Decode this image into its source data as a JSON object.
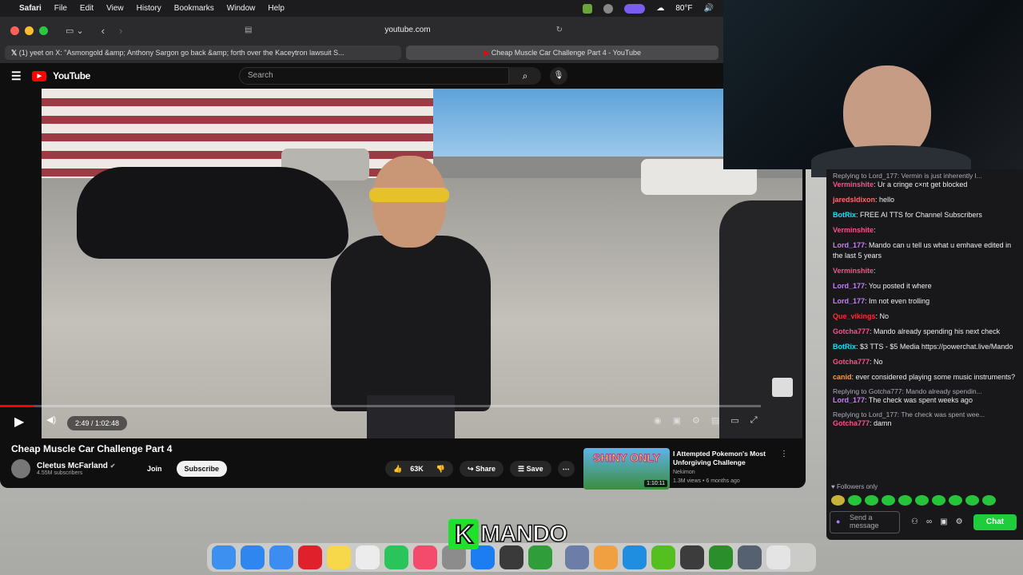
{
  "menubar": {
    "apple": "",
    "app": "Safari",
    "items": [
      "File",
      "Edit",
      "View",
      "History",
      "Bookmarks",
      "Window",
      "Help"
    ],
    "weather": "80°F"
  },
  "safari": {
    "url": "youtube.com",
    "tabs": [
      {
        "label": "(1) yeet on X: \"Asmongold &amp; Anthony Sargon go back &amp; forth over the Kaceytron lawsuit S..."
      },
      {
        "label": "Cheap Muscle Car Challenge Part 4 - YouTube"
      }
    ]
  },
  "youtube": {
    "logo": "YouTube",
    "search_placeholder": "Search",
    "video": {
      "time": "2:49 / 1:02:48",
      "progress": 0.045,
      "title": "Cheap Muscle Car Challenge Part 4",
      "channel": "Cleetus McFarland",
      "subscribers": "4.55M subscribers",
      "join": "Join",
      "subscribe": "Subscribe",
      "likes": "63K",
      "share": "Share",
      "save": "Save"
    },
    "related": {
      "title": "I Attempted Pokemon's Most Unforgiving Challenge",
      "channel": "Nekimon",
      "meta": "1.3M views • 6 months ago",
      "duration": "1:10:11",
      "thumb_text": "SHINY ONLY"
    }
  },
  "chat": {
    "messages": [
      {
        "type": "reply",
        "text": "Replying to Lord_177: Vermin is just inherently l..."
      },
      {
        "user": "Verminshite",
        "color": "#ff4f88",
        "text": "Ur a cringe c×nt get blocked"
      },
      {
        "user": "jaredsldixon",
        "color": "#ff6b6b",
        "text": "hello"
      },
      {
        "user": "BotRix",
        "color": "#00e8ff",
        "text": "FREE AI TTS for Channel Subscribers"
      },
      {
        "user": "Verminshite",
        "color": "#ff4f88",
        "text": ""
      },
      {
        "user": "Lord_177",
        "color": "#c77dff",
        "text": "Mando can u tell us what u emhave edited in the last 5 years"
      },
      {
        "user": "Verminshite",
        "color": "#ff4f88",
        "text": ""
      },
      {
        "user": "Lord_177",
        "color": "#c77dff",
        "text": "You posted it where"
      },
      {
        "user": "Lord_177",
        "color": "#c77dff",
        "text": "Im not even trolling"
      },
      {
        "user": "Que_vikings",
        "color": "#ff2d2d",
        "text": "No"
      },
      {
        "user": "Gotcha777",
        "color": "#ff4f88",
        "text": "Mando already spending his next check"
      },
      {
        "user": "BotRix",
        "color": "#00e8ff",
        "text": "$3 TTS - $5 Media https://powerchat.live/Mando"
      },
      {
        "user": "Gotcha777",
        "color": "#ff4f88",
        "text": "No"
      },
      {
        "user": "canid",
        "color": "#ff9a3c",
        "text": "ever considered playing some music instruments?"
      },
      {
        "type": "reply",
        "text": "Replying to Gotcha777: Mando already spendin..."
      },
      {
        "user": "Lord_177",
        "color": "#c77dff",
        "text": "The check was spent weeks ago"
      },
      {
        "type": "reply",
        "text": "Replying to Lord_177: The check was spent wee..."
      },
      {
        "user": "Gotcha777",
        "color": "#ff4f88",
        "text": "damn"
      }
    ],
    "followers_only": "Followers only",
    "input_placeholder": "Send a message",
    "chat_button": "Chat"
  },
  "overlay": {
    "brand_k": "K",
    "brand_text": "MANDO"
  },
  "dock": [
    "finder-icon",
    "safari-icon",
    "mail-icon",
    "opera-icon",
    "notes-icon",
    "reminders-icon",
    "whatsapp-icon",
    "music-icon",
    "settings-icon",
    "appstore-icon",
    "obs-icon",
    "xbox-icon",
    "finder2-icon",
    "photos-icon",
    "browser-icon",
    "kick-icon",
    "game-icon",
    "xbox2-icon",
    "monitor-icon",
    "trash-icon"
  ]
}
